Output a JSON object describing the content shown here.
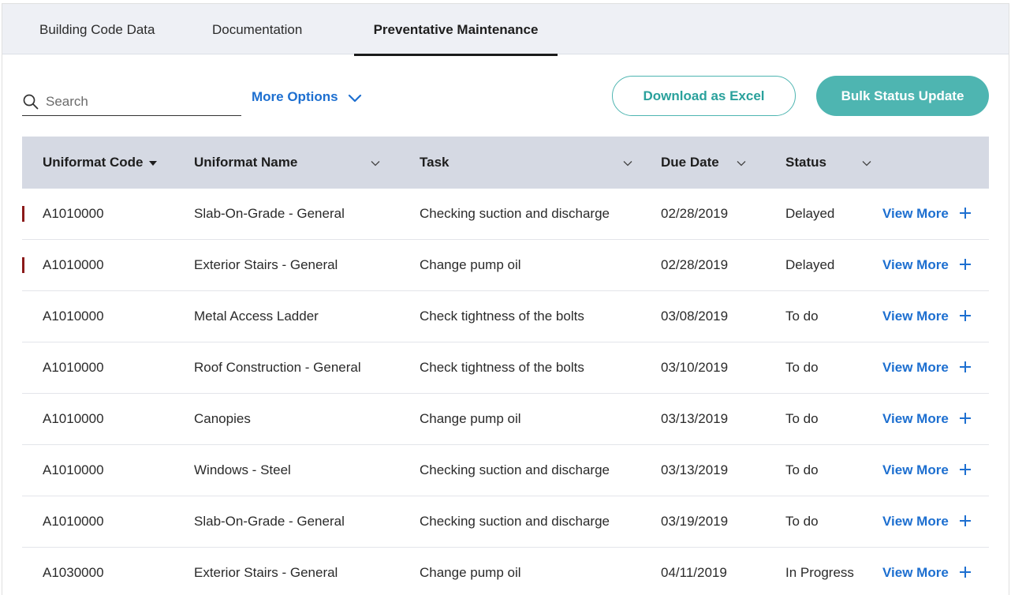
{
  "tabs": [
    {
      "label": "Building Code Data",
      "active": false
    },
    {
      "label": "Documentation",
      "active": false
    },
    {
      "label": "Preventative Maintenance",
      "active": true
    }
  ],
  "toolbar": {
    "search_placeholder": "Search",
    "search_value": "",
    "more_options_label": "More Options",
    "download_label": "Download as Excel",
    "bulk_update_label": "Bulk Status Update"
  },
  "table": {
    "columns": [
      {
        "label": "Uniformat Code",
        "sort": "desc"
      },
      {
        "label": "Uniformat Name",
        "sort": "none"
      },
      {
        "label": "Task",
        "sort": "none"
      },
      {
        "label": "Due Date",
        "sort": "none"
      },
      {
        "label": "Status",
        "sort": "none"
      }
    ],
    "view_more_label": "View More",
    "rows": [
      {
        "code": "A1010000",
        "name": "Slab-On-Grade - General",
        "task": "Checking suction and discharge",
        "due": "02/28/2019",
        "status": "Delayed",
        "flagged": true
      },
      {
        "code": "A1010000",
        "name": "Exterior Stairs - General",
        "task": "Change pump oil",
        "due": "02/28/2019",
        "status": "Delayed",
        "flagged": true
      },
      {
        "code": "A1010000",
        "name": "Metal Access Ladder",
        "task": "Check tightness of the bolts",
        "due": "03/08/2019",
        "status": "To do",
        "flagged": false
      },
      {
        "code": "A1010000",
        "name": "Roof Construction - General",
        "task": "Check tightness of the bolts",
        "due": "03/10/2019",
        "status": "To do",
        "flagged": false
      },
      {
        "code": "A1010000",
        "name": "Canopies",
        "task": "Change pump oil",
        "due": "03/13/2019",
        "status": "To do",
        "flagged": false
      },
      {
        "code": "A1010000",
        "name": "Windows - Steel",
        "task": "Checking suction and discharge",
        "due": "03/13/2019",
        "status": "To do",
        "flagged": false
      },
      {
        "code": "A1010000",
        "name": "Slab-On-Grade - General",
        "task": "Checking suction and discharge",
        "due": "03/19/2019",
        "status": "To do",
        "flagged": false
      },
      {
        "code": "A1030000",
        "name": "Exterior Stairs - General",
        "task": "Change pump oil",
        "due": "04/11/2019",
        "status": "In Progress",
        "flagged": false
      }
    ]
  },
  "colors": {
    "accent": "#4eb5b1",
    "link": "#1d6fd0",
    "header_bg": "#d5d9e3",
    "delayed_flag": "#8b1a1a"
  }
}
